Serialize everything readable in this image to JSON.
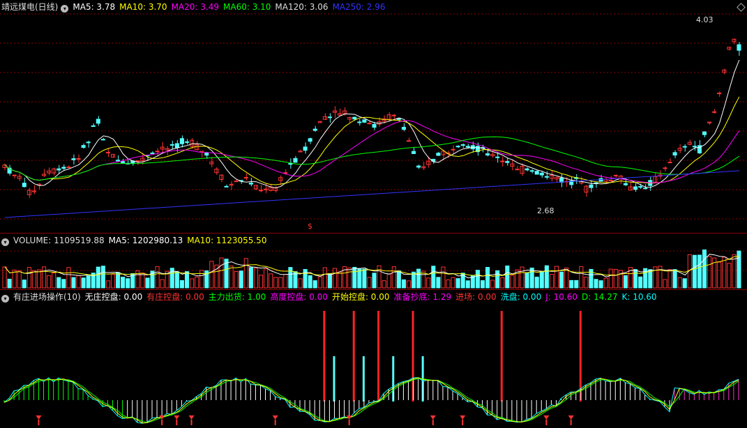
{
  "stock_title": "靖远煤电(日线)",
  "price_panel": {
    "indicators": [
      {
        "label": "MA5: 3.78",
        "color": "#ffffff"
      },
      {
        "label": "MA10: 3.70",
        "color": "#ffff00"
      },
      {
        "label": "MA20: 3.49",
        "color": "#ff00ff"
      },
      {
        "label": "MA60: 3.10",
        "color": "#00ff00"
      },
      {
        "label": "MA120: 3.06",
        "color": "#dddddd"
      },
      {
        "label": "MA250: 2.96",
        "color": "#3333ff"
      }
    ],
    "high_label": "4.03",
    "low_label": "2.68",
    "marker_symbol": "$"
  },
  "volume_panel": {
    "indicators": [
      {
        "label": "VOLUME: 1109519.88",
        "color": "#dddddd"
      },
      {
        "label": "MA5: 1202980.13",
        "color": "#ffffff"
      },
      {
        "label": "MA10: 1123055.50",
        "color": "#ffff00"
      }
    ]
  },
  "indicator_panel": {
    "name": "有庄进场操作(10)",
    "values": [
      {
        "label": "无庄控盘: 0.00",
        "color": "#ffffff"
      },
      {
        "label": "有庄控盘: 0.00",
        "color": "#ff3333"
      },
      {
        "label": "主力出货: 1.00",
        "color": "#00ff00"
      },
      {
        "label": "高度控盘: 0.00",
        "color": "#ff00ff"
      },
      {
        "label": "开始控盘: 0.00",
        "color": "#ffff00"
      },
      {
        "label": "准备抄底: 1.29",
        "color": "#ff00ff"
      },
      {
        "label": "进场: 0.00",
        "color": "#ff3333"
      },
      {
        "label": "洗盘: 0.00",
        "color": "#00ffff"
      },
      {
        "label": "J: 10.60",
        "color": "#ff00ff"
      },
      {
        "label": "D: 14.27",
        "color": "#00ff00"
      },
      {
        "label": "K: 10.60",
        "color": "#00ffff"
      }
    ]
  },
  "colors": {
    "up": "#ff3333",
    "down": "#54ffff",
    "grid": "#8b0000",
    "background": "#000000"
  }
}
